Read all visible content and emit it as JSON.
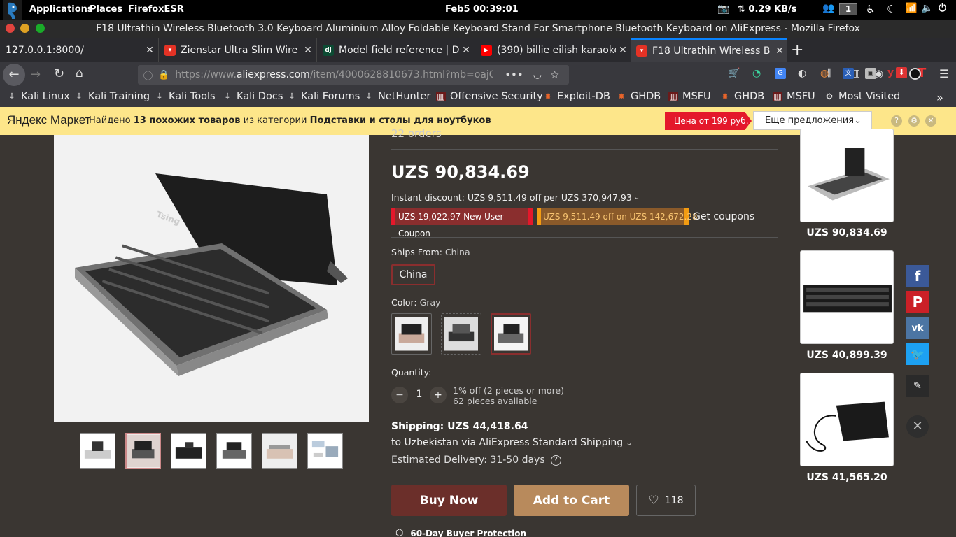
{
  "panel": {
    "applications": "Applications",
    "places": "Places",
    "firefox": "FirefoxESR",
    "datetime": "Feb5  00:39:01",
    "network_speed": "⇅ 0.29 KB/s",
    "workspace": "1"
  },
  "window": {
    "title": "F18 Ultrathin Wireless Bluetooth 3.0 Keyboard Aluminium Alloy Foldable Keyboard Stand For Smartphone Bluetooth Keyboard on AliExpress - Mozilla Firefox"
  },
  "tabs": [
    {
      "label": "127.0.0.1:8000/"
    },
    {
      "label": "Zienstar Ultra Slim Wire"
    },
    {
      "label": "Model field reference | D"
    },
    {
      "label": "(390) billie eilish karaoke"
    },
    {
      "label": "F18 Ultrathin Wireless B"
    }
  ],
  "url": {
    "prefix": "https://www.",
    "domain": "aliexpress.com",
    "path": "/item/4000628810673.html?mb=oajG("
  },
  "bookmarks": [
    {
      "label": "Kali Linux"
    },
    {
      "label": "Kali Training"
    },
    {
      "label": "Kali Tools"
    },
    {
      "label": "Kali Docs"
    },
    {
      "label": "Kali Forums"
    },
    {
      "label": "NetHunter"
    },
    {
      "label": "Offensive Security"
    },
    {
      "label": "Exploit-DB"
    },
    {
      "label": "GHDB"
    },
    {
      "label": "MSFU"
    },
    {
      "label": "GHDB"
    },
    {
      "label": "MSFU"
    },
    {
      "label": "Most Visited"
    }
  ],
  "yandex": {
    "logo": "Яндекс Маркет",
    "text_prefix": "Найдено ",
    "text_bold1": "13 похожих товаров",
    "text_mid": " из категории ",
    "text_bold2": "Подставки и столы для ноутбуков",
    "price_badge": "Цена от 199 руб.",
    "more_offers": "Еще предложения"
  },
  "product": {
    "orders": "22 orders",
    "price": "UZS 90,834.69",
    "instant_discount": "Instant discount: UZS 9,511.49 off per UZS 370,947.93",
    "coupon1": "UZS 19,022.97 New User Coupon",
    "coupon2": "UZS 9,511.49 off on UZS 142,672.28",
    "get_coupons": "Get coupons",
    "ships_from_label": "Ships From:",
    "ships_from_value": "China",
    "ships_option": "China",
    "color_label": "Color:",
    "color_value": "Gray",
    "quantity_label": "Quantity:",
    "quantity": "1",
    "qty_discount": "1% off (2 pieces or more)",
    "qty_available": "62 pieces available",
    "shipping_label": "Shipping: UZS 44,418.64",
    "shipping_to": "to Uzbekistan via AliExpress Standard Shipping",
    "delivery": "Estimated Delivery: 31-50 days",
    "buy_now": "Buy Now",
    "add_to_cart": "Add to Cart",
    "wishlist_count": "118",
    "protection": "60-Day Buyer Protection",
    "image_brand": "Tsing"
  },
  "related": [
    {
      "price": "UZS 90,834.69"
    },
    {
      "price": "UZS 40,899.39"
    },
    {
      "price": "UZS 41,565.20"
    }
  ],
  "colors": {
    "accent_red": "#e4393c",
    "buy_now_bg": "#6b2f2a",
    "add_cart_bg": "#b88a5c",
    "yandex_bar": "#fde68a",
    "tab_accent": "#0a84ff"
  }
}
